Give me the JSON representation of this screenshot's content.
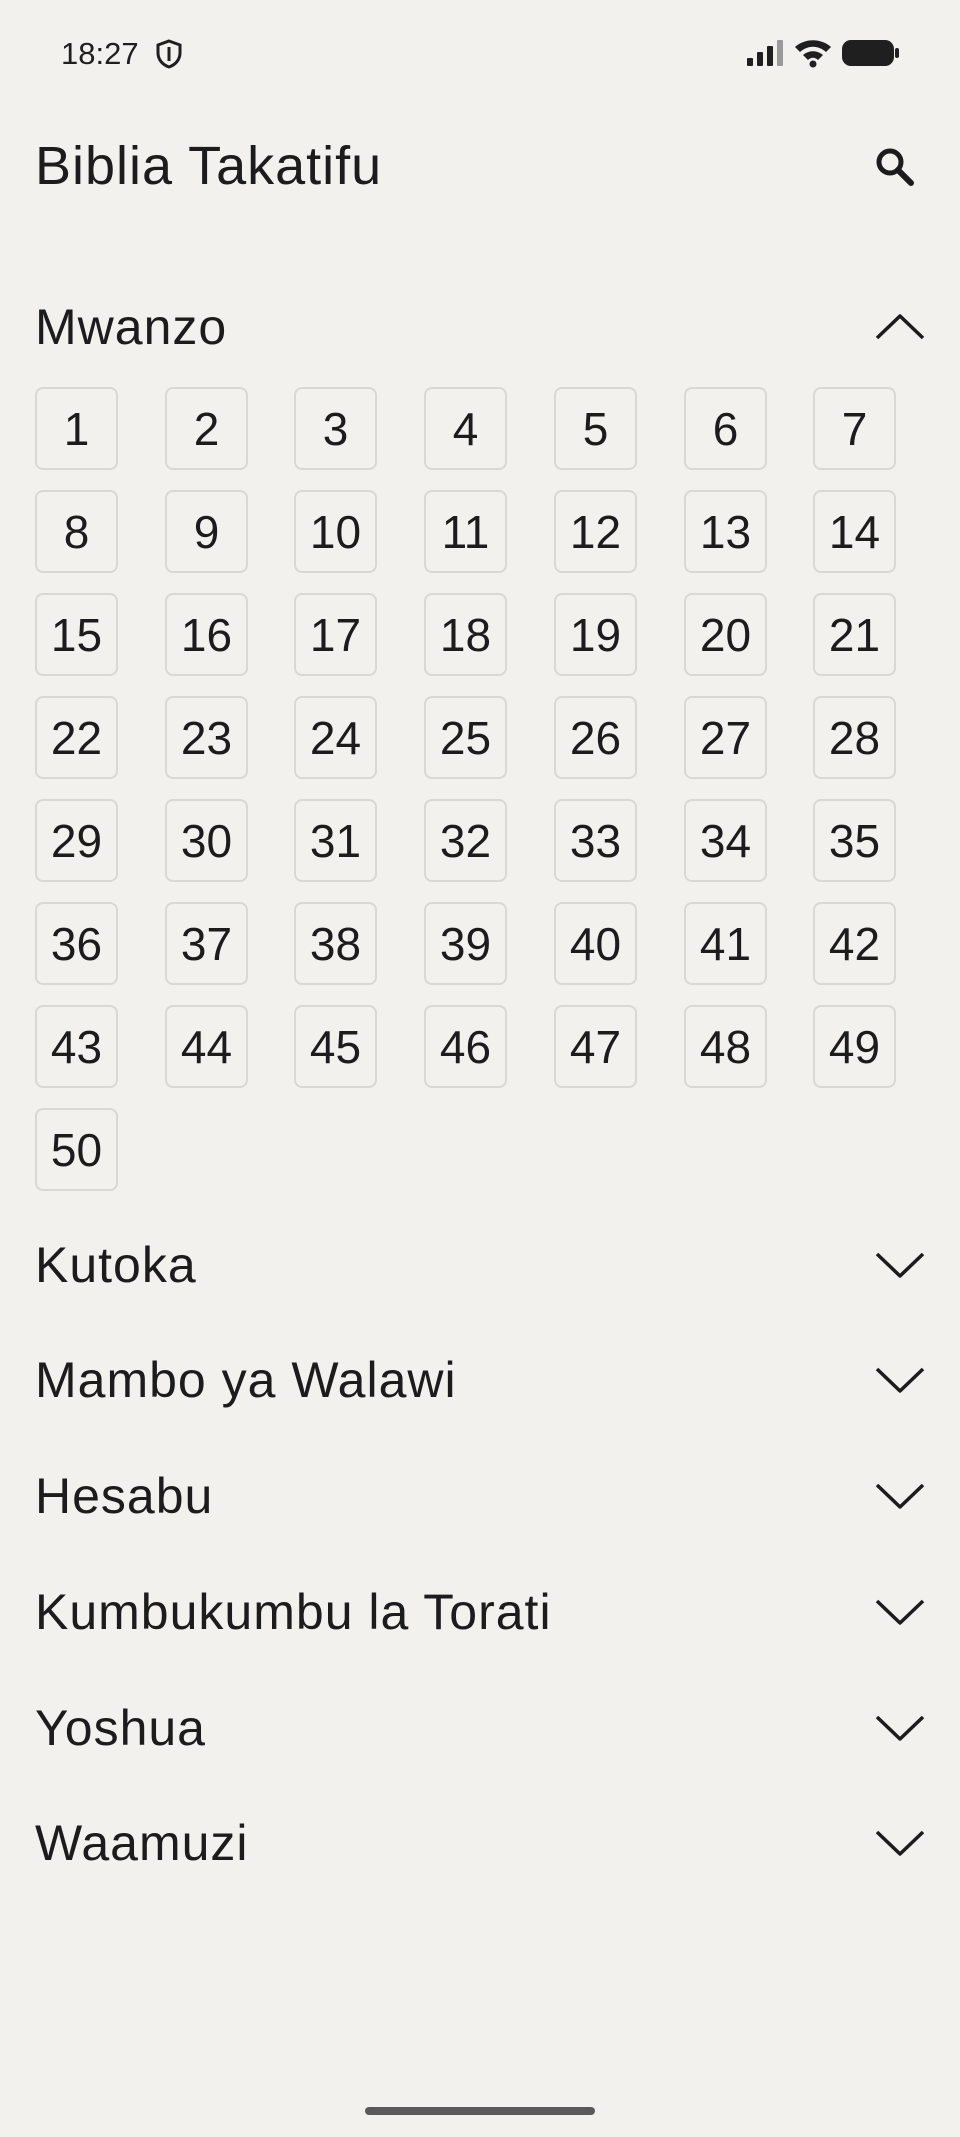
{
  "status": {
    "time": "18:27"
  },
  "header": {
    "title": "Biblia Takatifu",
    "search_icon": "search-icon"
  },
  "books": [
    {
      "name": "Mwanzo",
      "expanded": true,
      "chapters": [
        "1",
        "2",
        "3",
        "4",
        "5",
        "6",
        "7",
        "8",
        "9",
        "10",
        "11",
        "12",
        "13",
        "14",
        "15",
        "16",
        "17",
        "18",
        "19",
        "20",
        "21",
        "22",
        "23",
        "24",
        "25",
        "26",
        "27",
        "28",
        "29",
        "30",
        "31",
        "32",
        "33",
        "34",
        "35",
        "36",
        "37",
        "38",
        "39",
        "40",
        "41",
        "42",
        "43",
        "44",
        "45",
        "46",
        "47",
        "48",
        "49",
        "50"
      ]
    },
    {
      "name": "Kutoka",
      "expanded": false
    },
    {
      "name": "Mambo ya Walawi",
      "expanded": false
    },
    {
      "name": "Hesabu",
      "expanded": false
    },
    {
      "name": "Kumbukumbu la Torati",
      "expanded": false
    },
    {
      "name": "Yoshua",
      "expanded": false
    },
    {
      "name": "Waamuzi",
      "expanded": false
    }
  ],
  "colors": {
    "background": "#f2f1ee",
    "text": "#1c1c1c",
    "chip_border": "#d9d8d4"
  }
}
